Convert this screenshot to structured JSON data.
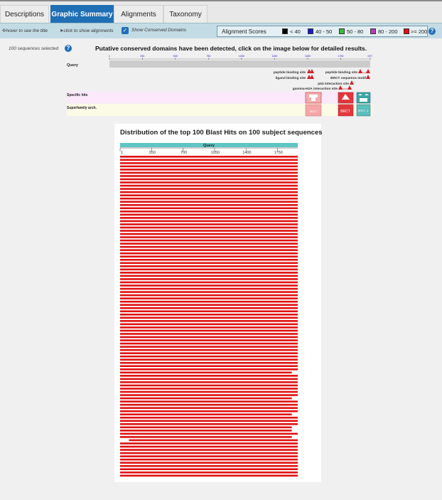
{
  "tabs": [
    {
      "label": "Descriptions",
      "active": false
    },
    {
      "label": "Graphic Summary",
      "active": true
    },
    {
      "label": "Alignments",
      "active": false
    },
    {
      "label": "Taxonomy",
      "active": false
    }
  ],
  "toolbar": {
    "hover_hint": "hover to see the title",
    "click_hint": "click to show alignments",
    "show_conserved_label": "Show Conserved Domains",
    "show_conserved_checked": true
  },
  "legend": {
    "title": "Alignment Scores",
    "items": [
      {
        "label": "< 40",
        "color": "#000000"
      },
      {
        "label": "40 - 50",
        "color": "#1a1ad0"
      },
      {
        "label": "50 - 80",
        "color": "#3cbb3c"
      },
      {
        "label": "80 - 200",
        "color": "#b83cb8"
      },
      {
        "label": ">= 200",
        "color": "#e01010"
      }
    ],
    "help": "?"
  },
  "selection": {
    "text": "100 sequences selected",
    "help": "?"
  },
  "conserved_domains": {
    "title": "Putative conserved domains have been detected, click on the image below for detailed results.",
    "query_label": "Query",
    "ticks": [
      "1",
      "250",
      "500",
      "750",
      "1000",
      "1250",
      "1500",
      "1750",
      "1973"
    ],
    "site_labels": [
      "peptide binding site",
      "peptide binding site",
      "ligand binding site",
      "BRCT sequence motif",
      "p53 interaction site",
      "gamma-H2A interaction site"
    ],
    "row_labels": [
      "Specific hits",
      "Superfamily arch."
    ],
    "domain_labels": [
      "BRCT",
      "BRCT_2",
      "BRCT",
      "BRCT_2"
    ],
    "colors": {
      "specific_row": "#fbe8fb",
      "superfamily_row": "#fbfbe6",
      "query_bar": "#cccccc",
      "domain_red": "#e3373b",
      "domain_teal": "#3aa7a4"
    }
  },
  "distribution": {
    "title": "Distribution of the top 100 Blast Hits on 100 subject sequences",
    "query_label": "Query",
    "ticks": [
      "1",
      "350",
      "700",
      "1050",
      "1400",
      "1750"
    ],
    "query_length": 1973,
    "hit_count": 100,
    "hit_color": "#e01010",
    "query_color": "#5fc4c4",
    "short_hits": [
      {
        "index": 67,
        "end": 1907
      },
      {
        "index": 75,
        "end": 1907
      },
      {
        "index": 80,
        "end": 1907
      },
      {
        "index": 84,
        "end": 1907
      },
      {
        "index": 85,
        "end": 1907
      },
      {
        "index": 87,
        "end": 1907
      }
    ],
    "gap_hits": [
      {
        "index": 88,
        "start": 100
      }
    ]
  }
}
